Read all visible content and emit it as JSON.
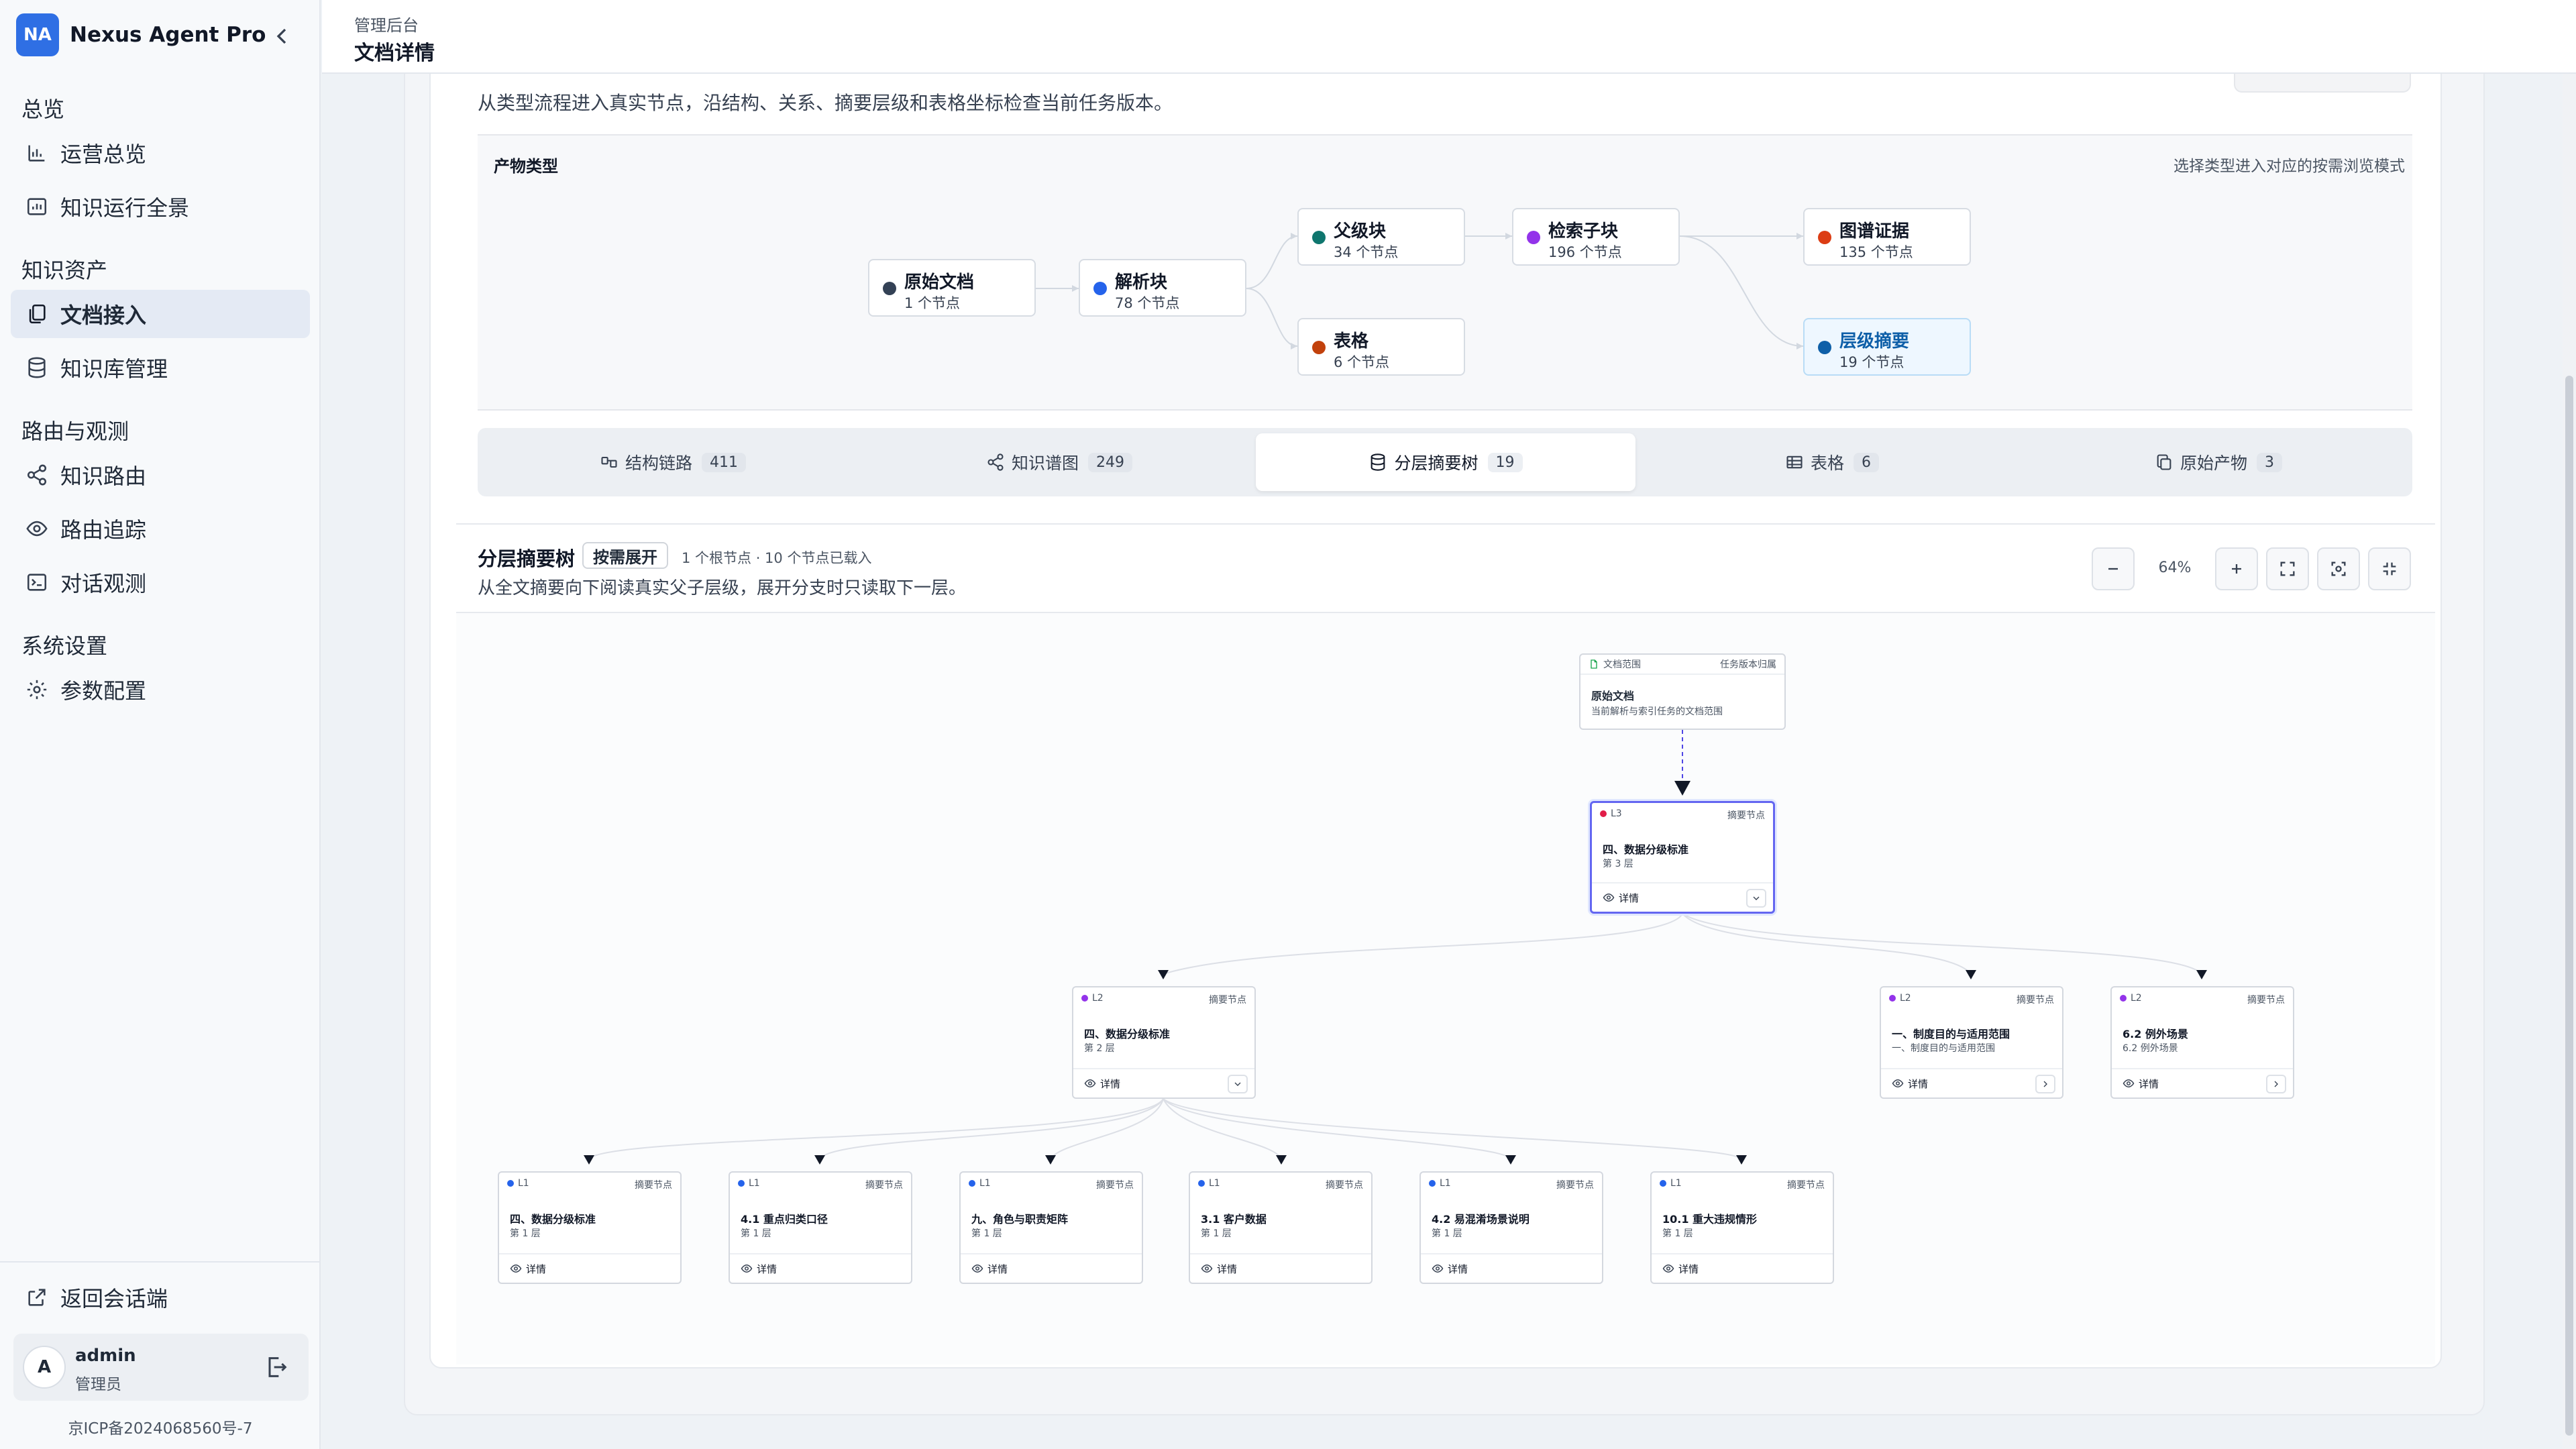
{
  "app": {
    "avatar": "NA",
    "name": "Nexus Agent Pro"
  },
  "sidebar": {
    "sections": [
      {
        "title": "总览",
        "items": [
          {
            "label": "运营总览",
            "icon": "chart-bar-icon"
          },
          {
            "label": "知识运行全景",
            "icon": "chart-panel-icon"
          }
        ]
      },
      {
        "title": "知识资产",
        "items": [
          {
            "label": "文档接入",
            "icon": "documents-icon",
            "active": true
          },
          {
            "label": "知识库管理",
            "icon": "database-icon"
          }
        ]
      },
      {
        "title": "路由与观测",
        "items": [
          {
            "label": "知识路由",
            "icon": "share-icon"
          },
          {
            "label": "路由追踪",
            "icon": "eye-icon"
          },
          {
            "label": "对话观测",
            "icon": "terminal-icon"
          }
        ]
      },
      {
        "title": "系统设置",
        "items": [
          {
            "label": "参数配置",
            "icon": "gear-icon"
          }
        ]
      }
    ],
    "back_to_chat": "返回会话端",
    "user": {
      "avatar": "A",
      "name": "admin",
      "role": "管理员"
    },
    "icp": "京ICP备2024068560号-7"
  },
  "header": {
    "breadcrumb_parent": "管理后台",
    "page_title": "文档详情"
  },
  "intro": "从类型流程进入真实节点，沿结构、关系、摘要层级和表格坐标检查当前任务版本。",
  "flow": {
    "title": "产物类型",
    "hint": "选择类型进入对应的按需浏览模式",
    "nodes": [
      {
        "name": "原始文档",
        "count": "1 个节点",
        "color": "#334155"
      },
      {
        "name": "解析块",
        "count": "78 个节点",
        "color": "#2563eb"
      },
      {
        "name": "父级块",
        "count": "34 个节点",
        "color": "#0f766e"
      },
      {
        "name": "表格",
        "count": "6 个节点",
        "color": "#c2410c"
      },
      {
        "name": "检索子块",
        "count": "196 个节点",
        "color": "#9333ea"
      },
      {
        "name": "图谱证据",
        "count": "135 个节点",
        "color": "#dc3d14"
      },
      {
        "name": "层级摘要",
        "count": "19 个节点",
        "color": "#0e5fa8"
      }
    ]
  },
  "tabs": [
    {
      "label": "结构链路",
      "count": "411",
      "icon": "structure-icon"
    },
    {
      "label": "知识谱图",
      "count": "249",
      "icon": "share-icon"
    },
    {
      "label": "分层摘要树",
      "count": "19",
      "icon": "database-icon",
      "active": true
    },
    {
      "label": "表格",
      "count": "6",
      "icon": "table-icon"
    },
    {
      "label": "原始产物",
      "count": "3",
      "icon": "copy-icon"
    }
  ],
  "tree": {
    "title": "分层摘要树",
    "tag": "按需展开",
    "meta": "1 个根节点 · 10 个节点已载入",
    "desc": "从全文摘要向下阅读真实父子层级，展开分支时只读取下一层。",
    "zoom": "64%",
    "root": {
      "scope": "文档范围",
      "task": "任务版本归属",
      "title": "原始文档",
      "sub": "当前解析与索引任务的文档范围"
    },
    "detail_label": "详情",
    "kind_label": "摘要节点",
    "nodes": {
      "n3": {
        "level": "L3",
        "title": "四、数据分级标准",
        "sub": "第 3 层"
      },
      "n2a": {
        "level": "L2",
        "title": "四、数据分级标准",
        "sub": "第 2 层"
      },
      "n2b": {
        "level": "L2",
        "title": "一、制度目的与适用范围",
        "sub": "一、制度目的与适用范围"
      },
      "n2c": {
        "level": "L2",
        "title": "6.2 例外场景",
        "sub": "6.2 例外场景"
      },
      "l1a": {
        "level": "L1",
        "title": "四、数据分级标准",
        "sub": "第 1 层"
      },
      "l1b": {
        "level": "L1",
        "title": "4.1 重点归类口径",
        "sub": "第 1 层"
      },
      "l1c": {
        "level": "L1",
        "title": "九、角色与职责矩阵",
        "sub": "第 1 层"
      },
      "l1d": {
        "level": "L1",
        "title": "3.1 客户数据",
        "sub": "第 1 层"
      },
      "l1e": {
        "level": "L1",
        "title": "4.2 易混淆场景说明",
        "sub": "第 1 层"
      },
      "l1f": {
        "level": "L1",
        "title": "10.1 重大违规情形",
        "sub": "第 1 层"
      }
    },
    "level_colors": {
      "L3": "#e11d48",
      "L2": "#9333ea",
      "L1": "#2563eb"
    }
  }
}
